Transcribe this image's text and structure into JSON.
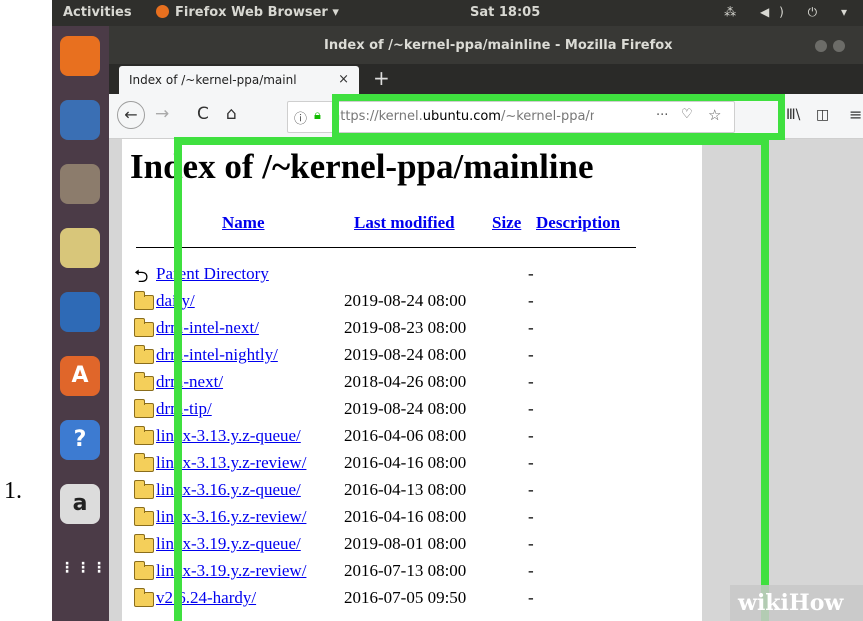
{
  "step_number": "1.",
  "ubuntu_topbar": {
    "activities": "Activities",
    "app_menu": "Firefox Web Browser ▾",
    "clock": "Sat 18:05",
    "tray": "⁂ ◀) ⏻ ▾"
  },
  "dock": [
    {
      "name": "firefox",
      "bg": "#e8701f",
      "glyph": ""
    },
    {
      "name": "thunderbird",
      "bg": "#3a6fb4",
      "glyph": ""
    },
    {
      "name": "files",
      "bg": "#8c7c6c",
      "glyph": ""
    },
    {
      "name": "rhythmbox",
      "bg": "#d8c67a",
      "glyph": ""
    },
    {
      "name": "writer",
      "bg": "#2e6ab6",
      "glyph": ""
    },
    {
      "name": "software",
      "bg": "#e0662a",
      "glyph": "A"
    },
    {
      "name": "help",
      "bg": "#3d7bd1",
      "glyph": "?"
    },
    {
      "name": "amazon",
      "bg": "#dcdcdc",
      "glyph": "a"
    },
    {
      "name": "show-apps",
      "bg": "transparent",
      "glyph": "⋮⋮⋮"
    }
  ],
  "window": {
    "title": "Index of /~kernel-ppa/mainline - Mozilla Firefox"
  },
  "tab": {
    "label": "Index of /~kernel-ppa/mainl",
    "close": "×",
    "new_tab": "+"
  },
  "toolbar": {
    "back": "←",
    "forward": "→",
    "reload": "C",
    "home": "⌂",
    "url_prefix": "https://kernel.",
    "url_domain": "ubuntu.com",
    "url_suffix": "/~kernel-ppa/mainline/",
    "page_actions": "···",
    "pocket": "♡",
    "bookmark_star": "☆",
    "library": "Ⅲ\\",
    "sidebar": "◫",
    "menu": "≡"
  },
  "page": {
    "heading": "Index of /~kernel-ppa/mainline",
    "columns": {
      "name": "Name",
      "last_modified": "Last modified",
      "size": "Size",
      "description": "Description"
    },
    "parent": {
      "name": "Parent Directory",
      "size": "-"
    },
    "rows": [
      {
        "name": "daily/",
        "modified": "2019-08-24 08:00",
        "size": "-"
      },
      {
        "name": "drm-intel-next/",
        "modified": "2019-08-23 08:00",
        "size": "-"
      },
      {
        "name": "drm-intel-nightly/",
        "modified": "2019-08-24 08:00",
        "size": "-"
      },
      {
        "name": "drm-next/",
        "modified": "2018-04-26 08:00",
        "size": "-"
      },
      {
        "name": "drm-tip/",
        "modified": "2019-08-24 08:00",
        "size": "-"
      },
      {
        "name": "linux-3.13.y.z-queue/",
        "modified": "2016-04-06 08:00",
        "size": "-"
      },
      {
        "name": "linux-3.13.y.z-review/",
        "modified": "2016-04-16 08:00",
        "size": "-"
      },
      {
        "name": "linux-3.16.y.z-queue/",
        "modified": "2016-04-13 08:00",
        "size": "-"
      },
      {
        "name": "linux-3.16.y.z-review/",
        "modified": "2016-04-16 08:00",
        "size": "-"
      },
      {
        "name": "linux-3.19.y.z-queue/",
        "modified": "2019-08-01 08:00",
        "size": "-"
      },
      {
        "name": "linux-3.19.y.z-review/",
        "modified": "2016-07-13 08:00",
        "size": "-"
      },
      {
        "name": "v2.6.24-hardy/",
        "modified": "2016-07-05 09:50",
        "size": "-"
      }
    ]
  },
  "watermark": {
    "part1": "wiki",
    "part2": "How"
  },
  "highlight_color": "#3fe03f"
}
